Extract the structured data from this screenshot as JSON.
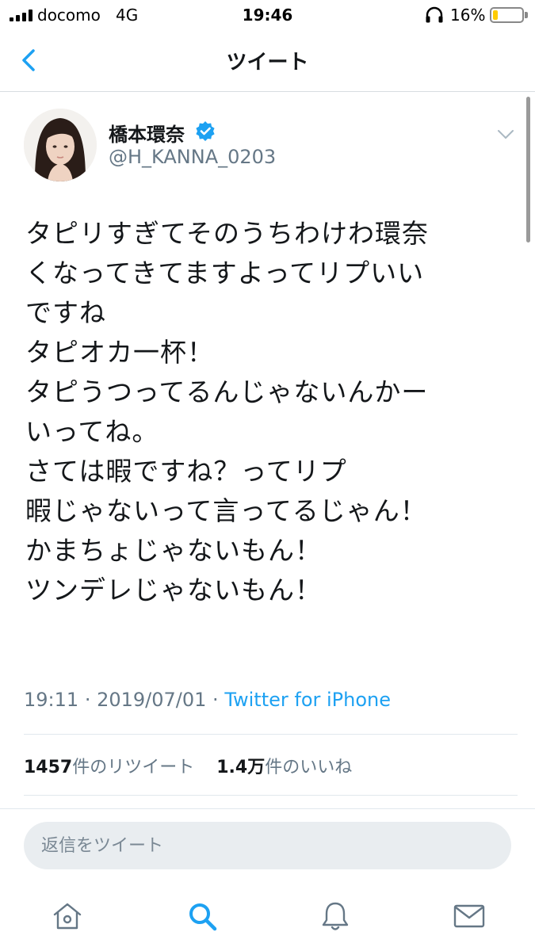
{
  "status_bar": {
    "carrier": "docomo",
    "network": "4G",
    "time": "19:46",
    "battery_percent": "16%",
    "battery_level": 0.16,
    "battery_color": "#ffcc00"
  },
  "nav": {
    "title": "ツイート",
    "back_icon": "chevron-left-icon",
    "accent_color": "#1da1f2"
  },
  "tweet": {
    "display_name": "橋本環奈",
    "verified": true,
    "username": "@H_KANNA_0203",
    "text_lines": [
      "タピリすぎてそのうちわけわ環奈",
      "くなってきてますよってリプいい",
      "ですね",
      "タピオカ一杯！",
      "タピうつってるんじゃないんかー",
      "いってね。",
      "さては暇ですね？ってリプ",
      "暇じゃないって言ってるじゃん！",
      "かまちょじゃないもん！",
      "ツンデレじゃないもん！"
    ],
    "time": "19:11",
    "date": "2019/07/01",
    "source": "Twitter for iPhone",
    "retweet_count": "1457",
    "retweet_label": "件のリツイート",
    "like_count": "1.4万",
    "like_label": "件のいいね"
  },
  "reply": {
    "placeholder": "返信をツイート"
  },
  "tab_bar": [
    {
      "name": "home-icon"
    },
    {
      "name": "search-icon",
      "active": true
    },
    {
      "name": "bell-icon"
    },
    {
      "name": "mail-icon"
    }
  ]
}
